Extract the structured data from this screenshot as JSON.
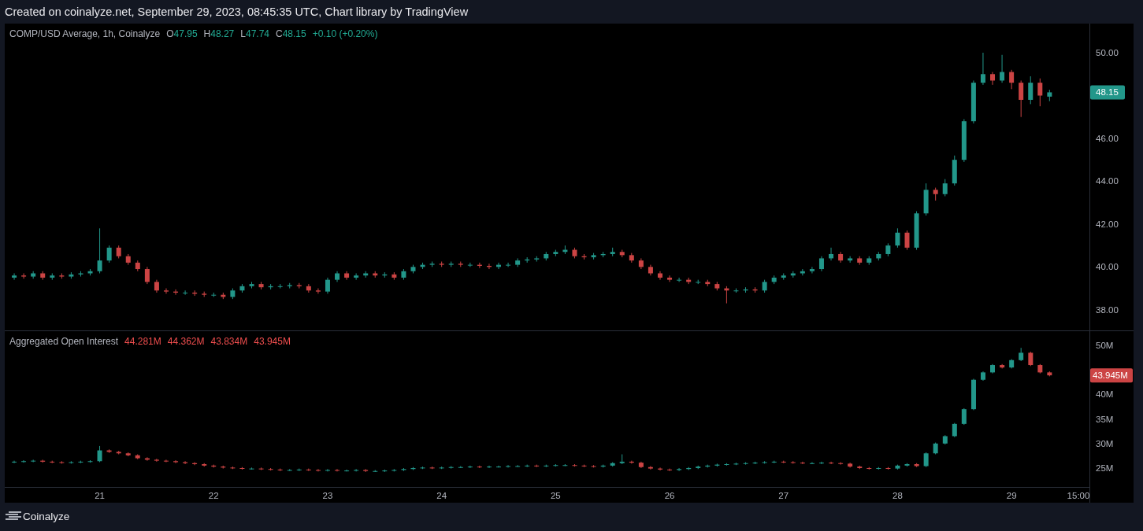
{
  "header": {
    "caption": "Created on coinalyze.net, September 29, 2023, 08:45:35 UTC, Chart library by TradingView"
  },
  "price_pane": {
    "title": "COMP/USD Average, 1h, Coinalyze",
    "ohlc": [
      {
        "label": "O",
        "value": "47.95"
      },
      {
        "label": "H",
        "value": "48.27"
      },
      {
        "label": "L",
        "value": "47.74"
      },
      {
        "label": "C",
        "value": "48.15"
      }
    ],
    "change": "+0.10 (+0.20%)",
    "last_value_tag": "48.15",
    "chart_data": {
      "type": "candlestick",
      "ylim": [
        37.0,
        51.36
      ],
      "yticks": [
        {
          "value": 38,
          "label": "38.00"
        },
        {
          "value": 40,
          "label": "40.00"
        },
        {
          "value": 42,
          "label": "42.00"
        },
        {
          "value": 44,
          "label": "44.00"
        },
        {
          "value": 46,
          "label": "46.00"
        },
        {
          "value": 50,
          "label": "50.00"
        }
      ],
      "categories": [
        null,
        null,
        null,
        null,
        null,
        null,
        null,
        null,
        null,
        null,
        null,
        null,
        null,
        null,
        null,
        null,
        null,
        null,
        null,
        null,
        null,
        null,
        null,
        null,
        null,
        null,
        null,
        null,
        null,
        null,
        null,
        null,
        null,
        null,
        null,
        null,
        null,
        null,
        null,
        null,
        null,
        null,
        null,
        null,
        null,
        null,
        null,
        null,
        null,
        null,
        null,
        null,
        null,
        null,
        null,
        null,
        null,
        null,
        null,
        null,
        null,
        null,
        null,
        null,
        null,
        null,
        null,
        null,
        null,
        null,
        null,
        null,
        null,
        null,
        null,
        null,
        null,
        null,
        null,
        null,
        null,
        null,
        null,
        null,
        null,
        null,
        null,
        null,
        null,
        null,
        null,
        null,
        null,
        null,
        null,
        null,
        null,
        null,
        null,
        null,
        null,
        null,
        null,
        null,
        null,
        null,
        null,
        null,
        null,
        null
      ],
      "ohlc": [
        [
          39.5,
          39.7,
          39.4,
          39.6
        ],
        [
          39.6,
          39.7,
          39.45,
          39.55
        ],
        [
          39.55,
          39.8,
          39.45,
          39.7
        ],
        [
          39.7,
          39.8,
          39.4,
          39.5
        ],
        [
          39.5,
          39.7,
          39.4,
          39.6
        ],
        [
          39.6,
          39.7,
          39.45,
          39.55
        ],
        [
          39.55,
          39.75,
          39.45,
          39.65
        ],
        [
          39.65,
          39.8,
          39.55,
          39.7
        ],
        [
          39.7,
          39.9,
          39.6,
          39.8
        ],
        [
          39.8,
          41.8,
          39.7,
          40.3
        ],
        [
          40.3,
          41.0,
          40.2,
          40.9
        ],
        [
          40.9,
          41.0,
          40.4,
          40.5
        ],
        [
          40.5,
          40.6,
          40.1,
          40.2
        ],
        [
          40.2,
          40.3,
          39.8,
          39.9
        ],
        [
          39.9,
          40.0,
          39.2,
          39.3
        ],
        [
          39.3,
          39.4,
          38.8,
          38.9
        ],
        [
          38.9,
          39.0,
          38.75,
          38.85
        ],
        [
          38.85,
          38.95,
          38.7,
          38.8
        ],
        [
          38.8,
          38.9,
          38.7,
          38.8
        ],
        [
          38.8,
          38.9,
          38.65,
          38.75
        ],
        [
          38.75,
          38.85,
          38.6,
          38.7
        ],
        [
          38.7,
          38.8,
          38.6,
          38.7
        ],
        [
          38.7,
          38.8,
          38.5,
          38.6
        ],
        [
          38.6,
          39.0,
          38.5,
          38.9
        ],
        [
          38.9,
          39.2,
          38.8,
          39.1
        ],
        [
          39.1,
          39.3,
          39.0,
          39.2
        ],
        [
          39.2,
          39.3,
          38.95,
          39.05
        ],
        [
          39.05,
          39.2,
          38.95,
          39.1
        ],
        [
          39.1,
          39.2,
          39.0,
          39.1
        ],
        [
          39.1,
          39.25,
          39.0,
          39.15
        ],
        [
          39.15,
          39.25,
          39.0,
          39.1
        ],
        [
          39.1,
          39.2,
          38.8,
          38.9
        ],
        [
          38.9,
          39.0,
          38.75,
          38.85
        ],
        [
          38.85,
          39.5,
          38.75,
          39.4
        ],
        [
          39.4,
          39.8,
          39.3,
          39.7
        ],
        [
          39.7,
          39.8,
          39.4,
          39.5
        ],
        [
          39.5,
          39.7,
          39.4,
          39.6
        ],
        [
          39.6,
          39.8,
          39.5,
          39.7
        ],
        [
          39.7,
          39.8,
          39.5,
          39.6
        ],
        [
          39.6,
          39.75,
          39.5,
          39.65
        ],
        [
          39.65,
          39.75,
          39.4,
          39.5
        ],
        [
          39.5,
          39.9,
          39.4,
          39.8
        ],
        [
          39.8,
          40.1,
          39.7,
          40.0
        ],
        [
          40.0,
          40.2,
          39.9,
          40.1
        ],
        [
          40.1,
          40.25,
          40.0,
          40.15
        ],
        [
          40.15,
          40.25,
          40.0,
          40.1
        ],
        [
          40.1,
          40.25,
          40.0,
          40.15
        ],
        [
          40.15,
          40.25,
          40.0,
          40.1
        ],
        [
          40.1,
          40.2,
          40.0,
          40.1
        ],
        [
          40.1,
          40.2,
          39.95,
          40.05
        ],
        [
          40.05,
          40.15,
          39.9,
          40.0
        ],
        [
          40.0,
          40.2,
          39.9,
          40.1
        ],
        [
          40.1,
          40.2,
          40.0,
          40.1
        ],
        [
          40.1,
          40.4,
          40.0,
          40.3
        ],
        [
          40.3,
          40.45,
          40.2,
          40.35
        ],
        [
          40.35,
          40.5,
          40.25,
          40.4
        ],
        [
          40.4,
          40.7,
          40.3,
          40.6
        ],
        [
          40.6,
          40.8,
          40.5,
          40.7
        ],
        [
          40.7,
          41.0,
          40.6,
          40.8
        ],
        [
          40.8,
          40.9,
          40.4,
          40.5
        ],
        [
          40.5,
          40.6,
          40.35,
          40.45
        ],
        [
          40.45,
          40.65,
          40.35,
          40.55
        ],
        [
          40.55,
          40.7,
          40.45,
          40.6
        ],
        [
          40.6,
          40.9,
          40.5,
          40.7
        ],
        [
          40.7,
          40.8,
          40.45,
          40.55
        ],
        [
          40.55,
          40.65,
          40.2,
          40.3
        ],
        [
          40.3,
          40.4,
          39.9,
          40.0
        ],
        [
          40.0,
          40.1,
          39.6,
          39.7
        ],
        [
          39.7,
          39.8,
          39.4,
          39.5
        ],
        [
          39.5,
          39.6,
          39.3,
          39.4
        ],
        [
          39.4,
          39.5,
          39.3,
          39.4
        ],
        [
          39.4,
          39.5,
          39.2,
          39.3
        ],
        [
          39.3,
          39.4,
          39.2,
          39.3
        ],
        [
          39.3,
          39.4,
          39.1,
          39.2
        ],
        [
          39.2,
          39.3,
          38.9,
          39.0
        ],
        [
          39.0,
          39.1,
          38.3,
          38.9
        ],
        [
          38.9,
          39.0,
          38.8,
          38.9
        ],
        [
          38.9,
          39.05,
          38.8,
          38.95
        ],
        [
          38.95,
          39.05,
          38.8,
          38.9
        ],
        [
          38.9,
          39.4,
          38.8,
          39.3
        ],
        [
          39.3,
          39.6,
          39.2,
          39.5
        ],
        [
          39.5,
          39.7,
          39.4,
          39.6
        ],
        [
          39.6,
          39.8,
          39.5,
          39.7
        ],
        [
          39.7,
          39.9,
          39.6,
          39.8
        ],
        [
          39.8,
          40.0,
          39.7,
          39.9
        ],
        [
          39.9,
          40.5,
          39.8,
          40.4
        ],
        [
          40.4,
          40.9,
          40.3,
          40.6
        ],
        [
          40.6,
          40.7,
          40.2,
          40.3
        ],
        [
          40.3,
          40.5,
          40.2,
          40.4
        ],
        [
          40.4,
          40.5,
          40.1,
          40.2
        ],
        [
          40.2,
          40.5,
          40.1,
          40.4
        ],
        [
          40.4,
          40.7,
          40.3,
          40.6
        ],
        [
          40.6,
          41.1,
          40.5,
          41.0
        ],
        [
          41.0,
          41.8,
          40.9,
          41.6
        ],
        [
          41.6,
          41.7,
          40.8,
          40.9
        ],
        [
          40.9,
          42.6,
          40.8,
          42.5
        ],
        [
          42.5,
          43.9,
          42.4,
          43.6
        ],
        [
          43.6,
          43.7,
          43.1,
          43.4
        ],
        [
          43.4,
          44.1,
          43.3,
          43.9
        ],
        [
          43.9,
          45.2,
          43.8,
          45.0
        ],
        [
          45.0,
          46.9,
          44.9,
          46.8
        ],
        [
          46.8,
          48.7,
          46.7,
          48.6
        ],
        [
          48.6,
          50.0,
          48.5,
          49.0
        ],
        [
          49.0,
          49.1,
          48.5,
          48.7
        ],
        [
          48.7,
          49.9,
          48.6,
          49.1
        ],
        [
          49.1,
          49.2,
          48.3,
          48.6
        ],
        [
          48.6,
          48.7,
          47.0,
          47.8
        ],
        [
          47.8,
          48.9,
          47.6,
          48.6
        ],
        [
          48.6,
          48.8,
          47.5,
          48.0
        ],
        [
          47.95,
          48.27,
          47.74,
          48.15
        ]
      ]
    }
  },
  "oi_pane": {
    "title": "Aggregated Open Interest",
    "time_axis_edge_label": "15:00",
    "values": [
      "44.281M",
      "44.362M",
      "43.834M",
      "43.945M"
    ],
    "last_value_tag": "43.945M",
    "chart_data": {
      "type": "candlestick",
      "xlim": [
        20.167,
        29.683
      ],
      "ylim": [
        21.15,
        52.9
      ],
      "yticks": [
        {
          "value": 25,
          "label": "25M"
        },
        {
          "value": 30,
          "label": "30M"
        },
        {
          "value": 35,
          "label": "35M"
        },
        {
          "value": 40,
          "label": "40M"
        },
        {
          "value": 50,
          "label": "50M"
        }
      ],
      "xticks": [
        {
          "value": 21,
          "label": "21"
        },
        {
          "value": 22,
          "label": "22"
        },
        {
          "value": 23,
          "label": "23"
        },
        {
          "value": 24,
          "label": "24"
        },
        {
          "value": 25,
          "label": "25"
        },
        {
          "value": 26,
          "label": "26"
        },
        {
          "value": 27,
          "label": "27"
        },
        {
          "value": 28,
          "label": "28"
        },
        {
          "value": 29,
          "label": "29"
        }
      ],
      "x": [
        20.25,
        20.333,
        20.417,
        20.5,
        20.583,
        20.667,
        20.75,
        20.833,
        20.917,
        21,
        21.083,
        21.167,
        21.25,
        21.333,
        21.417,
        21.5,
        21.583,
        21.667,
        21.75,
        21.833,
        21.917,
        22,
        22.083,
        22.167,
        22.25,
        22.333,
        22.417,
        22.5,
        22.583,
        22.667,
        22.75,
        22.833,
        22.917,
        23,
        23.083,
        23.167,
        23.25,
        23.333,
        23.417,
        23.5,
        23.583,
        23.667,
        23.75,
        23.833,
        23.917,
        24,
        24.083,
        24.167,
        24.25,
        24.333,
        24.417,
        24.5,
        24.583,
        24.667,
        24.75,
        24.833,
        24.917,
        25,
        25.083,
        25.167,
        25.25,
        25.333,
        25.417,
        25.5,
        25.583,
        25.667,
        25.75,
        25.833,
        25.917,
        26,
        26.083,
        26.167,
        26.25,
        26.333,
        26.417,
        26.5,
        26.583,
        26.667,
        26.75,
        26.833,
        26.917,
        27,
        27.083,
        27.167,
        27.25,
        27.333,
        27.417,
        27.5,
        27.583,
        27.667,
        27.75,
        27.833,
        27.917,
        28,
        28.083,
        28.167,
        28.25,
        28.333,
        28.417,
        28.5,
        28.583,
        28.667,
        28.75,
        28.833,
        28.917,
        29,
        29.083,
        29.167,
        29.25,
        29.333
      ],
      "ohlc": [
        [
          26.2,
          26.5,
          26.0,
          26.3
        ],
        [
          26.3,
          26.6,
          26.1,
          26.4
        ],
        [
          26.4,
          26.7,
          26.2,
          26.5
        ],
        [
          26.5,
          26.7,
          26.1,
          26.3
        ],
        [
          26.3,
          26.5,
          26.0,
          26.2
        ],
        [
          26.2,
          26.4,
          25.9,
          26.1
        ],
        [
          26.1,
          26.4,
          25.9,
          26.2
        ],
        [
          26.2,
          26.5,
          26.0,
          26.3
        ],
        [
          26.3,
          26.6,
          26.1,
          26.4
        ],
        [
          26.4,
          29.5,
          26.2,
          28.6
        ],
        [
          28.6,
          28.8,
          28.1,
          28.3
        ],
        [
          28.3,
          28.5,
          27.8,
          28.0
        ],
        [
          28.0,
          28.2,
          27.4,
          27.6
        ],
        [
          27.6,
          27.8,
          26.8,
          27.0
        ],
        [
          27.0,
          27.2,
          26.5,
          26.7
        ],
        [
          26.7,
          26.9,
          26.3,
          26.5
        ],
        [
          26.5,
          26.7,
          26.2,
          26.4
        ],
        [
          26.4,
          26.6,
          26.0,
          26.2
        ],
        [
          26.2,
          26.4,
          25.8,
          26.0
        ],
        [
          26.0,
          26.2,
          25.6,
          25.8
        ],
        [
          25.8,
          26.0,
          25.3,
          25.5
        ],
        [
          25.5,
          25.7,
          25.1,
          25.3
        ],
        [
          25.3,
          25.5,
          24.9,
          25.1
        ],
        [
          25.1,
          25.3,
          24.8,
          25.0
        ],
        [
          25.0,
          25.2,
          24.7,
          24.9
        ],
        [
          24.9,
          25.1,
          24.7,
          24.9
        ],
        [
          24.9,
          25.1,
          24.6,
          24.8
        ],
        [
          24.8,
          25.0,
          24.5,
          24.7
        ],
        [
          24.7,
          24.9,
          24.4,
          24.6
        ],
        [
          24.6,
          24.8,
          24.4,
          24.6
        ],
        [
          24.6,
          24.9,
          24.4,
          24.7
        ],
        [
          24.7,
          24.9,
          24.4,
          24.6
        ],
        [
          24.6,
          24.8,
          24.3,
          24.5
        ],
        [
          24.5,
          24.8,
          24.3,
          24.6
        ],
        [
          24.6,
          24.8,
          24.3,
          24.5
        ],
        [
          24.5,
          24.7,
          24.3,
          24.5
        ],
        [
          24.5,
          24.8,
          24.3,
          24.6
        ],
        [
          24.6,
          24.8,
          24.2,
          24.4
        ],
        [
          24.4,
          24.6,
          24.2,
          24.4
        ],
        [
          24.4,
          24.7,
          24.2,
          24.5
        ],
        [
          24.5,
          24.8,
          24.3,
          24.6
        ],
        [
          24.6,
          25.0,
          24.4,
          24.8
        ],
        [
          24.8,
          25.2,
          24.6,
          25.0
        ],
        [
          25.0,
          25.3,
          24.8,
          25.1
        ],
        [
          25.1,
          25.3,
          24.8,
          25.0
        ],
        [
          25.0,
          25.3,
          24.8,
          25.1
        ],
        [
          25.1,
          25.4,
          24.9,
          25.2
        ],
        [
          25.2,
          25.4,
          25.0,
          25.2
        ],
        [
          25.2,
          25.5,
          25.0,
          25.3
        ],
        [
          25.3,
          25.5,
          25.0,
          25.2
        ],
        [
          25.2,
          25.5,
          25.0,
          25.3
        ],
        [
          25.3,
          25.5,
          25.1,
          25.3
        ],
        [
          25.3,
          25.6,
          25.1,
          25.4
        ],
        [
          25.4,
          25.6,
          25.2,
          25.4
        ],
        [
          25.4,
          25.7,
          25.2,
          25.5
        ],
        [
          25.5,
          25.7,
          25.2,
          25.4
        ],
        [
          25.4,
          25.7,
          25.2,
          25.5
        ],
        [
          25.5,
          25.8,
          25.3,
          25.6
        ],
        [
          25.6,
          25.8,
          25.4,
          25.6
        ],
        [
          25.6,
          25.8,
          25.3,
          25.5
        ],
        [
          25.5,
          25.7,
          25.2,
          25.4
        ],
        [
          25.4,
          25.6,
          25.1,
          25.3
        ],
        [
          25.3,
          25.7,
          25.1,
          25.5
        ],
        [
          25.5,
          26.2,
          25.3,
          26.0
        ],
        [
          26.0,
          27.8,
          25.8,
          26.3
        ],
        [
          26.3,
          26.5,
          25.9,
          26.1
        ],
        [
          26.1,
          26.3,
          25.0,
          25.2
        ],
        [
          25.2,
          25.4,
          24.7,
          24.9
        ],
        [
          24.9,
          25.1,
          24.5,
          24.7
        ],
        [
          24.7,
          24.9,
          24.4,
          24.6
        ],
        [
          24.6,
          25.0,
          24.4,
          24.8
        ],
        [
          24.8,
          25.2,
          24.6,
          25.0
        ],
        [
          25.0,
          25.5,
          24.8,
          25.3
        ],
        [
          25.3,
          25.7,
          25.1,
          25.5
        ],
        [
          25.5,
          25.9,
          25.3,
          25.7
        ],
        [
          25.7,
          26.0,
          25.5,
          25.8
        ],
        [
          25.8,
          26.1,
          25.6,
          25.9
        ],
        [
          25.9,
          26.2,
          25.7,
          26.0
        ],
        [
          26.0,
          26.3,
          25.8,
          26.1
        ],
        [
          26.1,
          26.4,
          25.9,
          26.2
        ],
        [
          26.2,
          26.5,
          26.0,
          26.3
        ],
        [
          26.3,
          26.5,
          26.0,
          26.2
        ],
        [
          26.2,
          26.4,
          25.9,
          26.1
        ],
        [
          26.1,
          26.3,
          25.8,
          26.0
        ],
        [
          26.0,
          26.2,
          25.8,
          26.0
        ],
        [
          26.0,
          26.3,
          25.8,
          26.1
        ],
        [
          26.1,
          26.3,
          25.8,
          26.0
        ],
        [
          26.0,
          26.2,
          25.7,
          25.9
        ],
        [
          25.9,
          26.1,
          25.1,
          25.3
        ],
        [
          25.3,
          25.5,
          24.8,
          25.0
        ],
        [
          25.0,
          25.2,
          24.7,
          24.9
        ],
        [
          24.9,
          25.2,
          24.7,
          25.0
        ],
        [
          25.0,
          25.2,
          24.7,
          24.9
        ],
        [
          24.9,
          25.7,
          24.7,
          25.5
        ],
        [
          25.5,
          26.0,
          25.3,
          25.8
        ],
        [
          25.8,
          26.0,
          25.2,
          25.4
        ],
        [
          25.4,
          28.2,
          25.2,
          28.0
        ],
        [
          28.0,
          30.2,
          27.8,
          30.0
        ],
        [
          30.0,
          31.7,
          29.8,
          31.5
        ],
        [
          31.5,
          34.2,
          31.3,
          34.0
        ],
        [
          34.0,
          37.2,
          33.8,
          37.0
        ],
        [
          37.0,
          43.2,
          36.8,
          43.0
        ],
        [
          43.0,
          44.7,
          42.8,
          44.5
        ],
        [
          44.5,
          46.2,
          44.3,
          46.0
        ],
        [
          46.0,
          46.2,
          45.3,
          45.5
        ],
        [
          45.5,
          47.2,
          45.3,
          47.0
        ],
        [
          47.0,
          49.5,
          46.8,
          48.5
        ],
        [
          48.5,
          48.7,
          45.8,
          46.0
        ],
        [
          46.0,
          46.2,
          44.3,
          44.5
        ],
        [
          44.5,
          44.7,
          43.7,
          43.9
        ]
      ]
    }
  },
  "footer": {
    "brand": "Coinalyze"
  }
}
